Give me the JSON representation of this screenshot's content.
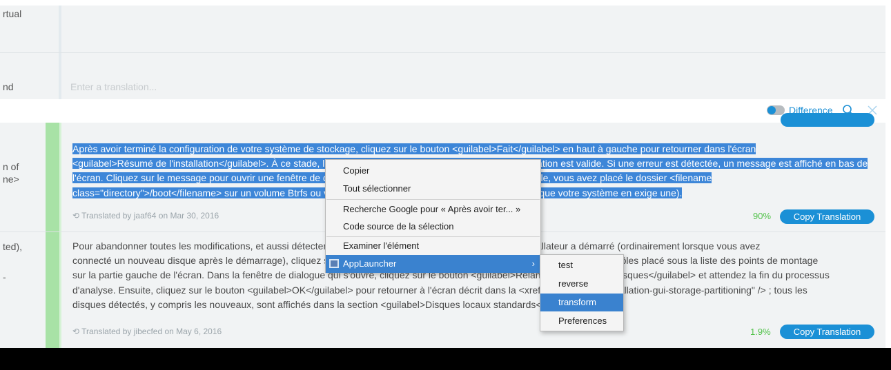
{
  "upper": {
    "frag1": "rtual",
    "frag2": "nd",
    "placeholder": "Enter a translation..."
  },
  "toolbar": {
    "difference_label": "Difference",
    "toggle_on": true
  },
  "entry1": {
    "left_frag1": "n of",
    "left_frag2": "ne>",
    "lines": [
      "Après avoir terminé la configuration de votre système de stockage, cliquez sur le bouton <guilabel>Fait</guilabel> en haut à gauche pour retourner dans l'écran",
      "<guilabel>Résumé de l'installation</guilabel>. À ce stade, le programme d'installation vérifie si votre configuration est valide. Si une erreur est détectée, un message est affiché en bas de",
      "l'écran. Cliquez sur le message pour ouvrir une fenêtre de dialogue décrivant le type d'erreur faite (par exemple, vous avez placé le dossier <filename",
      "class=\"directory\">/boot</filename> sur un volume Btrfs ou vous n'avez pas créé de partition BIOS Boot alors que votre système en exige une)."
    ],
    "meta": "Translated by jaaf64 on Mar 30, 2016",
    "percent": "90%",
    "copy_label": "Copy Translation"
  },
  "entry2": {
    "left_frag1": "ted),",
    "left_frag2": "-",
    "lines": [
      "Pour abandonner toutes les modifications, et aussi détecter les nouveaux disques non détectés lorsque l'installateur a démarré (ordinairement lorsque vous avez",
      "connecté un nouveau disque après le démarrage), cliquez sur le bouton <guilabel>Réinitialiser</guilabel> dans la barre de contrôles placé sous la liste des points de montage",
      "sur la partie gauche de l'écran. Dans la fenêtre de dialogue qui s'ouvre, cliquez sur le bouton <guilabel>Relancer l'analyse des disques</guilabel> et attendez la fin du processus",
      "d'analyse. Ensuite, cliquez sur le bouton <guilabel>OK</guilabel> pour retourner à l'écran décrit dans la <xref linkend=\"sect-installation-gui-storage-partitioning\" /> ; tous les",
      "disques détectés, y compris les nouveaux, sont affichés dans la section <guilabel>Disques locaux standards</guilabel>."
    ],
    "meta": "Translated by jibecfed on May 6, 2016",
    "percent": "1.9%",
    "copy_label": "Copy Translation"
  },
  "context_menu": {
    "items": [
      {
        "label": "Copier",
        "mnemonic": "p"
      },
      {
        "label": "Tout sélectionner",
        "mnemonic": "T"
      },
      {
        "label": "Recherche Google pour « Après avoir ter... »",
        "mnemonic": "R"
      },
      {
        "label": "Code source de la sélection",
        "mnemonic": "e"
      },
      {
        "label": "Examiner l'élément",
        "mnemonic": "x"
      },
      {
        "label": "AppLauncher",
        "mnemonic": "",
        "submenu_arrow": "›"
      }
    ]
  },
  "submenu": {
    "items": [
      "test",
      "reverse",
      "transform",
      "Preferences"
    ],
    "active": "transform"
  },
  "colors": {
    "accent": "#1b90d6",
    "selection": "#3d86d8",
    "approved_green": "#a8e2a6",
    "menu_highlight": "#3a82cf"
  }
}
